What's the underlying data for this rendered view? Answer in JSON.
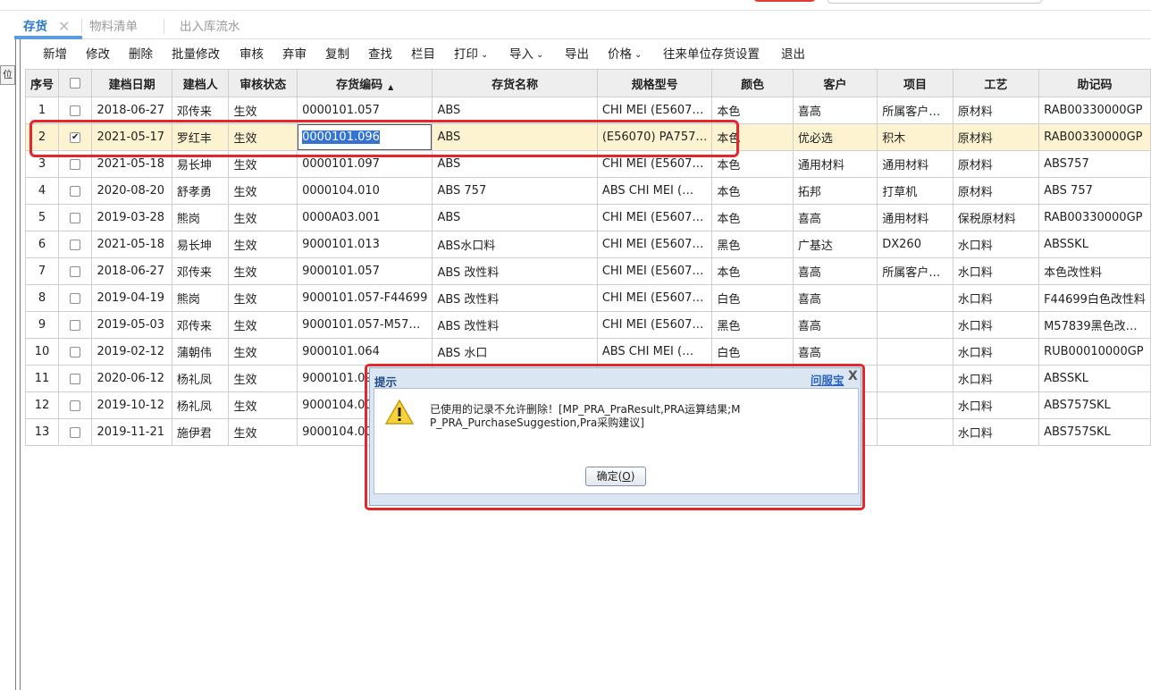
{
  "tabs": [
    {
      "label": "存货",
      "active": true
    },
    {
      "label": "物料清单",
      "active": false
    },
    {
      "label": "出入库流水",
      "active": false
    }
  ],
  "side_tab": "位",
  "toolbar": [
    {
      "label": "新增",
      "has_menu": false
    },
    {
      "label": "修改",
      "has_menu": false
    },
    {
      "label": "删除",
      "has_menu": false
    },
    {
      "label": "批量修改",
      "has_menu": false
    },
    {
      "label": "审核",
      "has_menu": false
    },
    {
      "label": "弃审",
      "has_menu": false
    },
    {
      "label": "复制",
      "has_menu": false
    },
    {
      "label": "查找",
      "has_menu": false
    },
    {
      "label": "栏目",
      "has_menu": false
    },
    {
      "label": "打印",
      "has_menu": true
    },
    {
      "label": "导入",
      "has_menu": true
    },
    {
      "label": "导出",
      "has_menu": false
    },
    {
      "label": "价格",
      "has_menu": true
    },
    {
      "label": "往来单位存货设置",
      "has_menu": false
    },
    {
      "label": "退出",
      "has_menu": false
    }
  ],
  "columns": [
    "序号",
    "",
    "建档日期",
    "建档人",
    "审核状态",
    "存货编码",
    "存货名称",
    "规格型号",
    "颜色",
    "客户",
    "项目",
    "工艺",
    "助记码"
  ],
  "sorted_column": "存货编码",
  "rows": [
    {
      "no": "1",
      "checked": false,
      "date": "2018-06-27",
      "creator": "邓传来",
      "status": "生效",
      "code": "0000101.057",
      "name": "ABS",
      "spec": "CHI MEI (E5607…",
      "color": "本色",
      "customer": "喜高",
      "project": "所属客户…",
      "craft": "原材料",
      "mnemonic": "RAB00330000GP"
    },
    {
      "no": "2",
      "checked": true,
      "date": "2021-05-17",
      "creator": "罗红丰",
      "status": "生效",
      "code": "0000101.096",
      "name": "ABS",
      "spec": "(E56070) PA757…",
      "color": "本色",
      "customer": "优必选",
      "project": "积木",
      "craft": "原材料",
      "mnemonic": "RAB00330000GP"
    },
    {
      "no": "3",
      "checked": false,
      "date": "2021-05-18",
      "creator": "易长坤",
      "status": "生效",
      "code": "0000101.097",
      "name": "ABS",
      "spec": "CHI MEI (E5607…",
      "color": "本色",
      "customer": "通用材料",
      "project": "通用材料",
      "craft": "原材料",
      "mnemonic": "ABS757"
    },
    {
      "no": "4",
      "checked": false,
      "date": "2020-08-20",
      "creator": "舒孝勇",
      "status": "生效",
      "code": "0000104.010",
      "name": "ABS 757",
      "spec": "ABS CHI MEI (…",
      "color": "本色",
      "customer": "拓邦",
      "project": "打草机",
      "craft": "原材料",
      "mnemonic": "ABS 757"
    },
    {
      "no": "5",
      "checked": false,
      "date": "2019-03-28",
      "creator": "熊岗",
      "status": "生效",
      "code": "0000A03.001",
      "name": "ABS",
      "spec": "CHI MEI (E5607…",
      "color": "本色",
      "customer": "喜高",
      "project": "通用材料",
      "craft": "保税原材料",
      "mnemonic": "RAB00330000GP"
    },
    {
      "no": "6",
      "checked": false,
      "date": "2021-05-18",
      "creator": "易长坤",
      "status": "生效",
      "code": "9000101.013",
      "name": "ABS水口料",
      "spec": "CHI MEI (E5607…",
      "color": "黑色",
      "customer": "广基达",
      "project": "DX260",
      "craft": "水口料",
      "mnemonic": "ABSSKL"
    },
    {
      "no": "7",
      "checked": false,
      "date": "2018-06-27",
      "creator": "邓传来",
      "status": "生效",
      "code": "9000101.057",
      "name": "ABS 改性料",
      "spec": "CHI MEI (E5607…",
      "color": "本色",
      "customer": "喜高",
      "project": "所属客户…",
      "craft": "水口料",
      "mnemonic": "本色改性料"
    },
    {
      "no": "8",
      "checked": false,
      "date": "2019-04-19",
      "creator": "熊岗",
      "status": "生效",
      "code": "9000101.057-F44699",
      "name": "ABS 改性料",
      "spec": "CHI MEI (E5607…",
      "color": "白色",
      "customer": "喜高",
      "project": "",
      "craft": "水口料",
      "mnemonic": "F44699白色改性料"
    },
    {
      "no": "9",
      "checked": false,
      "date": "2019-05-03",
      "creator": "邓传来",
      "status": "生效",
      "code": "9000101.057-M57…",
      "name": "ABS 改性料",
      "spec": "CHI MEI (E5607…",
      "color": "黑色",
      "customer": "喜高",
      "project": "",
      "craft": "水口料",
      "mnemonic": "M57839黑色改…"
    },
    {
      "no": "10",
      "checked": false,
      "date": "2019-02-12",
      "creator": "蒲朝伟",
      "status": "生效",
      "code": "9000101.064",
      "name": "ABS 水口",
      "spec": "ABS CHI MEI (…",
      "color": "白色",
      "customer": "喜高",
      "project": "",
      "craft": "水口料",
      "mnemonic": "RUB00010000GP"
    },
    {
      "no": "11",
      "checked": false,
      "date": "2020-06-12",
      "creator": "杨礼凤",
      "status": "生效",
      "code": "9000101.09",
      "name": "",
      "spec": "",
      "color": "",
      "customer": "",
      "project": "",
      "craft": "水口料",
      "mnemonic": "ABSSKL"
    },
    {
      "no": "12",
      "checked": false,
      "date": "2019-10-12",
      "creator": "杨礼凤",
      "status": "生效",
      "code": "9000104.00",
      "name": "",
      "spec": "",
      "color": "",
      "customer": "",
      "project": "",
      "craft": "水口料",
      "mnemonic": "ABS757SKL"
    },
    {
      "no": "13",
      "checked": false,
      "date": "2019-11-21",
      "creator": "施伊君",
      "status": "生效",
      "code": "9000104.00",
      "name": "",
      "spec": "",
      "color": "",
      "customer": "",
      "project": "",
      "craft": "水口料",
      "mnemonic": "ABS757SKL"
    }
  ],
  "dialog": {
    "title": "提示",
    "help_link": "问服宝",
    "close_symbol": "X",
    "message": "已使用的记录不允许删除！[MP_PRA_PraResult,PRA运算结果;MP_PRA_PurchaseSuggestion,Pra采购建议]",
    "ok_label": "确定(",
    "ok_key": "O",
    "ok_suffix": ")"
  },
  "colors": {
    "accent": "#2b79c9",
    "selected_row": "#fdf3d0",
    "annotation": "#e5262b"
  }
}
